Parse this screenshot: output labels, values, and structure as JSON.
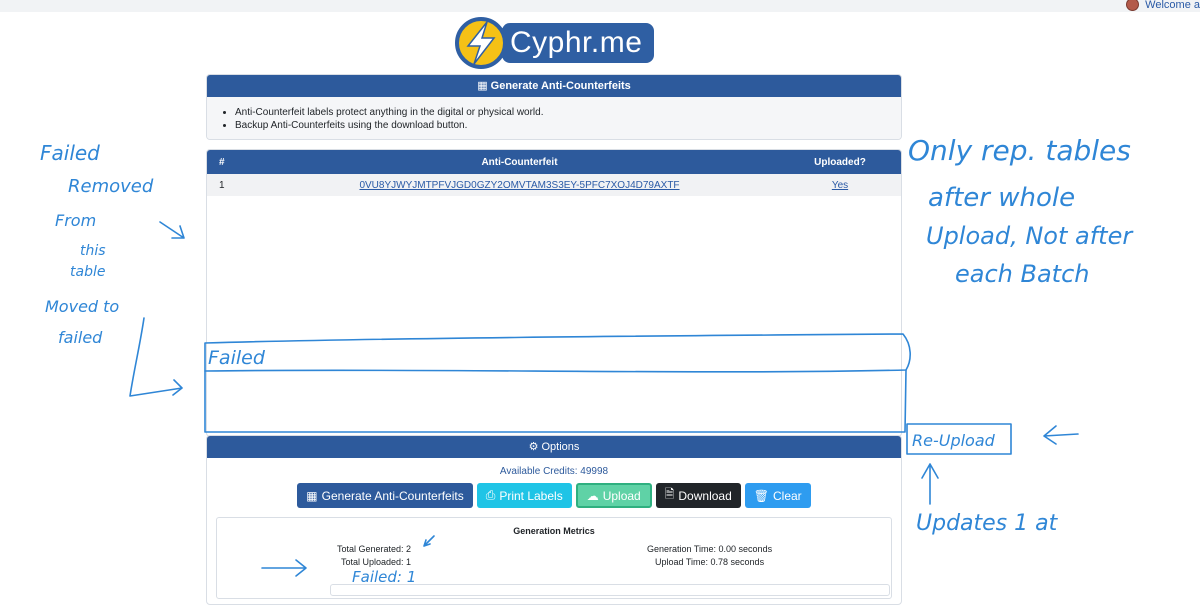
{
  "header": {
    "welcome_text": "Welcome a"
  },
  "logo": {
    "text": "Cyphr.me"
  },
  "generate_card": {
    "title": "Generate Anti-Counterfeits",
    "bullets": [
      "Anti-Counterfeit labels protect anything in the digital or physical world.",
      "Backup Anti-Counterfeits using the download button."
    ]
  },
  "results_table": {
    "columns": [
      "#",
      "Anti-Counterfeit",
      "Uploaded?"
    ],
    "rows": [
      {
        "num": "1",
        "code": "0VU8YJWYJMTPFVJGD0GZY2OMVTAM3S3EY-5PFC7XOJ4D79AXTF",
        "uploaded": "Yes"
      }
    ]
  },
  "options_card": {
    "title": "Options",
    "credits": "Available Credits: 49998",
    "buttons": {
      "generate": "Generate Anti-Counterfeits",
      "print": "Print Labels",
      "upload": "Upload",
      "download": "Download",
      "clear": "Clear"
    },
    "metrics": {
      "title": "Generation Metrics",
      "total_generated": "Total Generated: 2",
      "total_uploaded": "Total Uploaded: 1",
      "generation_time": "Generation Time: 0.00 seconds",
      "upload_time": "Upload Time: 0.78 seconds"
    }
  },
  "annotations": {
    "left_note": [
      "Failed",
      "Removed",
      "From",
      "this",
      "table",
      "Moved to",
      "failed"
    ],
    "failed_section": "Failed",
    "right_note": [
      "Only rep. tables",
      "after whole",
      "Upload, Not after",
      "each Batch"
    ],
    "reupload": "Re-Upload",
    "updates": "Updates 1 at",
    "failed_count": "Failed: 1"
  },
  "colors": {
    "primary": "#2d5a9c",
    "annotation": "#2f86d6",
    "info": "#1fc4e6",
    "success": "#5fd2a6",
    "dark": "#212529",
    "accent": "#2e9cf0"
  }
}
